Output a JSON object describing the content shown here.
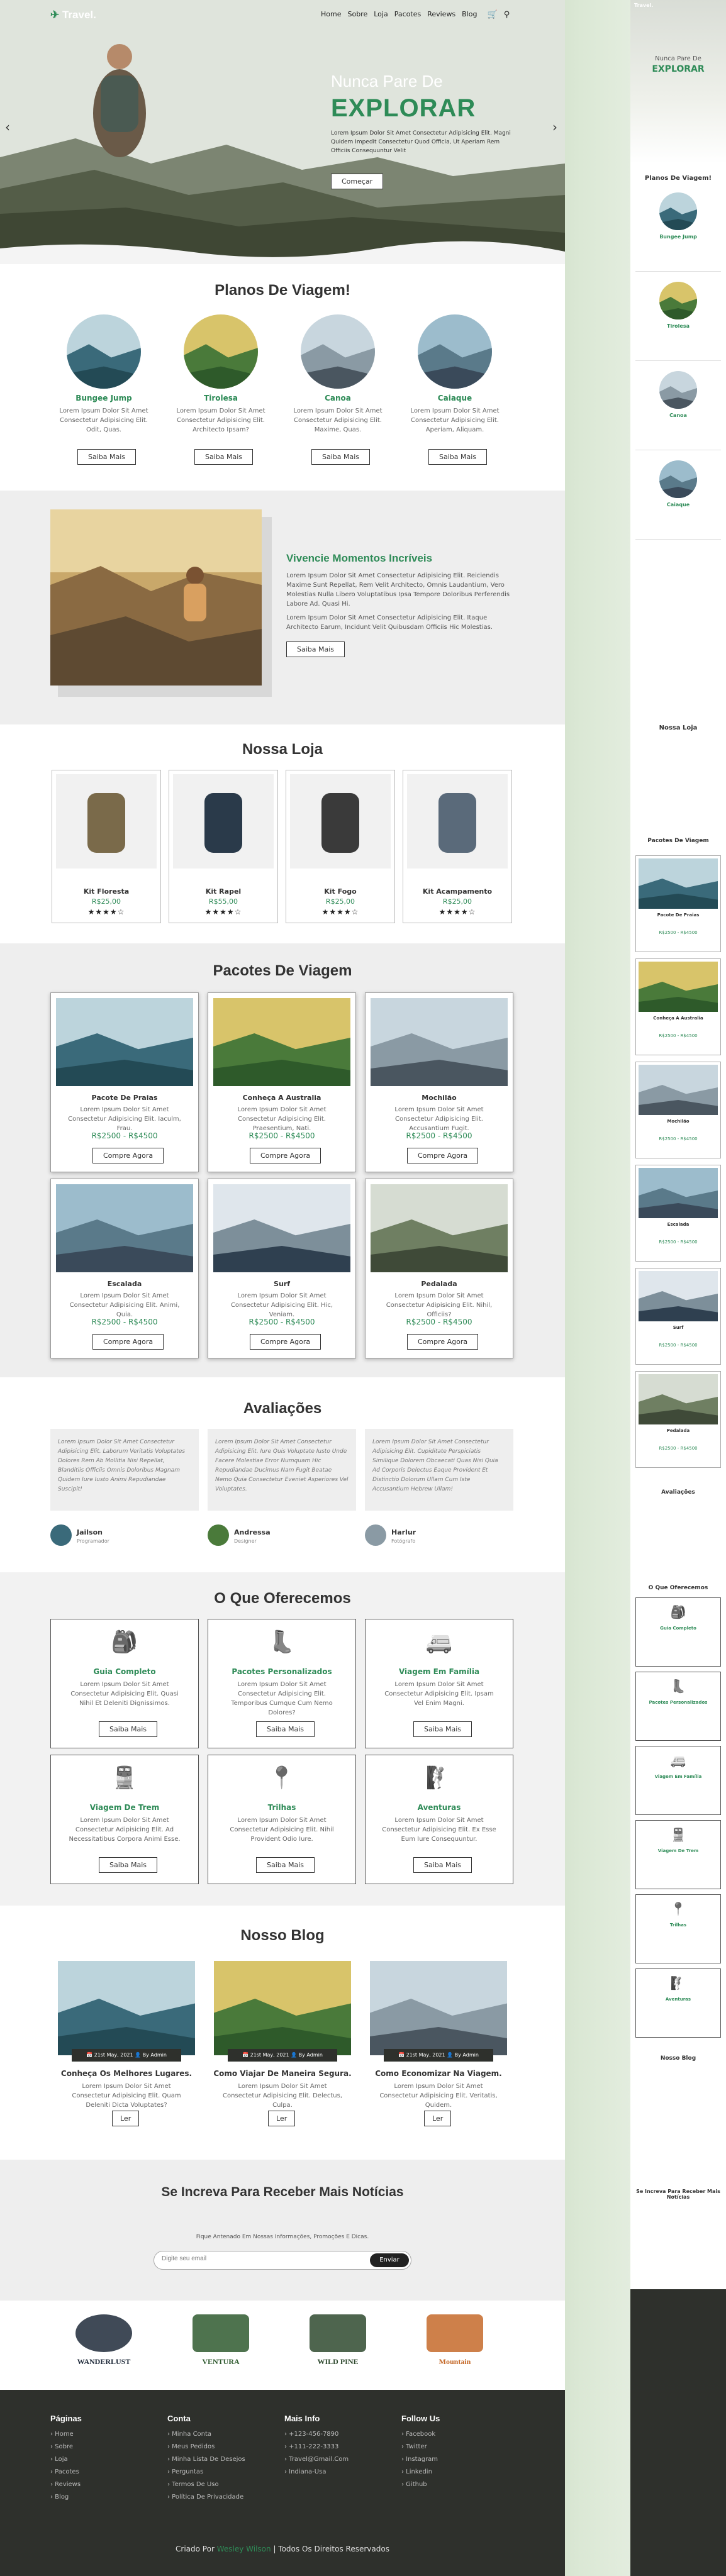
{
  "brand": "Travel.",
  "nav": [
    "Home",
    "Sobre",
    "Loja",
    "Pacotes",
    "Reviews",
    "Blog"
  ],
  "hero": {
    "pre": "Nunca Pare De",
    "title": "EXPLORAR",
    "text": "Lorem Ipsum Dolor Sit Amet Consectetur Adipisicing Elit. Magni Quidem Impedit Consectetur Quod Officia, Ut Aperiam Rem Officiis Consequuntur Velit",
    "button": "Começar"
  },
  "plans": {
    "title": "Planos De Viagem!",
    "button": "Saiba Mais",
    "items": [
      {
        "name": "Bungee Jump",
        "text": "Lorem Ipsum Dolor Sit Amet Consectetur Adipisicing Elit. Odit, Quas."
      },
      {
        "name": "Tirolesa",
        "text": "Lorem Ipsum Dolor Sit Amet Consectetur Adipisicing Elit. Architecto Ipsam?"
      },
      {
        "name": "Canoa",
        "text": "Lorem Ipsum Dolor Sit Amet Consectetur Adipisicing Elit. Maxime, Quas."
      },
      {
        "name": "Caiaque",
        "text": "Lorem Ipsum Dolor Sit Amet Consectetur Adipisicing Elit. Aperiam, Aliquam."
      }
    ]
  },
  "moments": {
    "title": "Vivencie Momentos Incríveis",
    "p1": "Lorem Ipsum Dolor Sit Amet Consectetur Adipisicing Elit. Reiciendis Maxime Sunt Repellat, Rem Velit Architecto, Omnis Laudantium, Vero Molestias Nulla Libero Voluptatibus Ipsa Tempore Doloribus Perferendis Labore Ad. Quasi Hi.",
    "p2": "Lorem Ipsum Dolor Sit Amet Consectetur Adipisicing Elit. Itaque Architecto Earum, Incidunt Velit Quibusdam Officiis Hic Molestias.",
    "button": "Saiba Mais"
  },
  "shop": {
    "title": "Nossa Loja",
    "items": [
      {
        "name": "Kit Floresta",
        "price": "R$25,00"
      },
      {
        "name": "Kit Rapel",
        "price": "R$55,00"
      },
      {
        "name": "Kit Fogo",
        "price": "R$25,00"
      },
      {
        "name": "Kit Acampamento",
        "price": "R$25,00"
      }
    ],
    "stars": "★★★★☆"
  },
  "packages": {
    "title": "Pacotes De Viagem",
    "button": "Compre Agora",
    "items": [
      {
        "name": "Pacote De Praias",
        "text": "Lorem Ipsum Dolor Sit Amet Consectetur Adipisicing Elit. Iaculm, Frau.",
        "price": "R$2500 - R$4500"
      },
      {
        "name": "Conheça A Australia",
        "text": "Lorem Ipsum Dolor Sit Amet Consectetur Adipisicing Elit. Praesentium, Nati.",
        "price": "R$2500 - R$4500"
      },
      {
        "name": "Mochilão",
        "text": "Lorem Ipsum Dolor Sit Amet Consectetur Adipisicing Elit. Accusantium Fugit.",
        "price": "R$2500 - R$4500"
      },
      {
        "name": "Escalada",
        "text": "Lorem Ipsum Dolor Sit Amet Consectetur Adipisicing Elit. Animi, Quia.",
        "price": "R$2500 - R$4500"
      },
      {
        "name": "Surf",
        "text": "Lorem Ipsum Dolor Sit Amet Consectetur Adipisicing Elit. Hic, Veniam.",
        "price": "R$2500 - R$4500"
      },
      {
        "name": "Pedalada",
        "text": "Lorem Ipsum Dolor Sit Amet Consectetur Adipisicing Elit. Nihil, Officiis?",
        "price": "R$2500 - R$4500"
      }
    ]
  },
  "reviews": {
    "title": "Avaliações",
    "items": [
      {
        "text": "Lorem Ipsum Dolor Sit Amet Consectetur Adipisicing Elit. Laborum Veritatis Voluptates Dolores Rem Ab Mollitia Nisi Repellat, Blanditiis Officiis Omnis Doloribus Magnam Quidem Iure Iusto Animi Repudiandae Suscipit!",
        "name": "Jailson",
        "role": "Programador"
      },
      {
        "text": "Lorem Ipsum Dolor Sit Amet Consectetur Adipisicing Elit. Iure Quis Voluptate Iusto Unde Facere Molestiae Error Numquam Hic Repudiandae Ducimus Nam Fugit Beatae Nemo Quia Consectetur Eveniet Asperiores Vel Voluptates.",
        "name": "Andressa",
        "role": "Designer"
      },
      {
        "text": "Lorem Ipsum Dolor Sit Amet Consectetur Adipisicing Elit. Cupiditate Perspiciatis Similique Dolorem Obcaecati Quas Nisi Quia Ad Corporis Delectus Eaque Provident Et Distinctio Dolorum Ullam Cum Iste Accusantium Hebrew Ullam!",
        "name": "Harlur",
        "role": "Fotógrafo"
      }
    ]
  },
  "services": {
    "title": "O Que Oferecemos",
    "button": "Saiba Mais",
    "items": [
      {
        "name": "Guia Completo",
        "icon": "backpack-icon",
        "text": "Lorem Ipsum Dolor Sit Amet Consectetur Adipisicing Elit. Quasi Nihil Et Deleniti Dignissimos."
      },
      {
        "name": "Pacotes Personalizados",
        "icon": "boot-icon",
        "text": "Lorem Ipsum Dolor Sit Amet Consectetur Adipisicing Elit. Temporibus Cumque Cum Nemo Dolores?"
      },
      {
        "name": "Viagem Em Família",
        "icon": "rv-icon",
        "text": "Lorem Ipsum Dolor Sit Amet Consectetur Adipisicing Elit. Ipsam Vel Enim Magni."
      },
      {
        "name": "Viagem De Trem",
        "icon": "train-icon",
        "text": "Lorem Ipsum Dolor Sit Amet Consectetur Adipisicing Elit. Ad Necessitatibus Corpora Animi Esse."
      },
      {
        "name": "Trilhas",
        "icon": "route-icon",
        "text": "Lorem Ipsum Dolor Sit Amet Consectetur Adipisicing Elit. Nihil Provident Odio Iure."
      },
      {
        "name": "Aventuras",
        "icon": "climber-icon",
        "text": "Lorem Ipsum Dolor Sit Amet Consectetur Adipisicing Elit. Ex Esse Eum Iure Consequuntur."
      }
    ]
  },
  "blog": {
    "title": "Nosso Blog",
    "button": "Ler",
    "items": [
      {
        "date": "21st May, 2021",
        "author": "By Admin",
        "title": "Conheça Os Melhores Lugares.",
        "text": "Lorem Ipsum Dolor Sit Amet Consectetur Adipisicing Elit. Quam Deleniti Dicta Voluptates?"
      },
      {
        "date": "21st May, 2021",
        "author": "By Admin",
        "title": "Como Viajar De Maneira Segura.",
        "text": "Lorem Ipsum Dolor Sit Amet Consectetur Adipisicing Elit. Delectus, Culpa."
      },
      {
        "date": "21st May, 2021",
        "author": "By Admin",
        "title": "Como Economizar Na Viagem.",
        "text": "Lorem Ipsum Dolor Sit Amet Consectetur Adipisicing Elit. Veritatis, Quidem."
      }
    ]
  },
  "newsletter": {
    "title": "Se Increva Para Receber Mais Notícias",
    "sub": "Fique Antenado Em Nossas Informações, Promoções E Dicas.",
    "placeholder": "Digite seu email",
    "button": "Enviar"
  },
  "brands": [
    "WANDERLUST",
    "VENTURA",
    "WILD PINE",
    "Mountain"
  ],
  "footer": {
    "cols": [
      {
        "title": "Páginas",
        "items": [
          "Home",
          "Sobre",
          "Loja",
          "Pacotes",
          "Reviews",
          "Blog"
        ]
      },
      {
        "title": "Conta",
        "items": [
          "Minha Conta",
          "Meus Pedidos",
          "Minha Lista De Desejos",
          "Perguntas",
          "Termos De Uso",
          "Política De Privacidade"
        ]
      },
      {
        "title": "Mais Info",
        "items": [
          "+123-456-7890",
          "+111-222-3333",
          "Travel@Gmail.Com",
          "Indiana-Usa"
        ]
      },
      {
        "title": "Follow Us",
        "items": [
          "Facebook",
          "Twitter",
          "Instagram",
          "Linkedin",
          "Github"
        ]
      }
    ],
    "credit_pre": "Criado Por",
    "credit_name": "Wesley Wilson",
    "credit_post": "| Todos Os Direitos Reservados"
  },
  "mobile": {
    "hero_pre": "Nunca Pare De",
    "hero_title": "EXPLORAR",
    "plans_title": "Planos De Viagem!",
    "shop_title": "Nossa Loja",
    "packages_title": "Pacotes De Viagem",
    "reviews_title": "Avaliações",
    "services_title": "O Que Oferecemos",
    "blog_title": "Nosso Blog",
    "news_title": "Se Increva Para Receber Mais Notícias"
  }
}
